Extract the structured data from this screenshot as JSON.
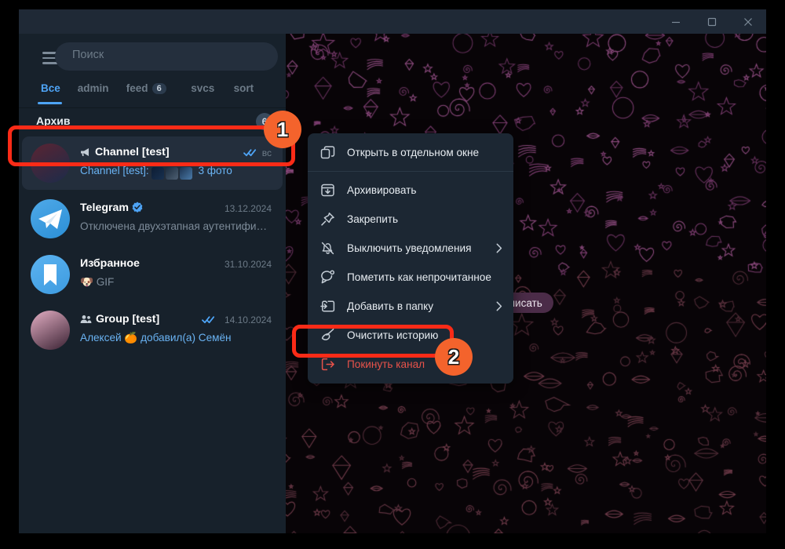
{
  "window": {
    "controls": [
      {
        "name": "minimize",
        "glyph": "minimize-icon"
      },
      {
        "name": "maximize",
        "glyph": "maximize-icon"
      },
      {
        "name": "close",
        "glyph": "close-icon"
      }
    ]
  },
  "sidebar": {
    "menu_icon": "hamburger-menu-icon",
    "search": {
      "placeholder": "Поиск",
      "value": ""
    },
    "tabs": [
      {
        "label": "Все",
        "badge": "",
        "active": true
      },
      {
        "label": "admin",
        "badge": "",
        "active": false
      },
      {
        "label": "feed",
        "badge": "6",
        "active": false
      },
      {
        "label": "svcs",
        "badge": "",
        "active": false
      },
      {
        "label": "sort",
        "badge": "",
        "active": false
      }
    ],
    "archive": {
      "label": "Архив",
      "count": "6"
    },
    "chats": [
      {
        "name": "Channel [test]",
        "name_prefix_icon": "megaphone-icon",
        "preview_prefix": "Channel [test]:",
        "preview": "3 фото",
        "preview_has_thumbs": true,
        "time": "вс",
        "read_ticks": true,
        "verified": false,
        "selected": true,
        "avatar_colors": [
          "#5a2432",
          "#1c2b4a"
        ]
      },
      {
        "name": "Telegram",
        "name_prefix_icon": "",
        "preview_prefix": "",
        "preview": "Отключена двухэтапная аутентификация!…",
        "preview_has_thumbs": false,
        "time": "13.12.2024",
        "read_ticks": false,
        "verified": true,
        "selected": false,
        "avatar_colors": [
          "#4fa9e8",
          "#2b8fd6"
        ]
      },
      {
        "name": "Избранное",
        "name_prefix_icon": "",
        "preview_prefix": "",
        "preview": "🐶 GIF",
        "preview_has_thumbs": false,
        "time": "31.10.2024",
        "read_ticks": false,
        "verified": false,
        "selected": false,
        "avatar_colors": [
          "#5cb3f0",
          "#3d9be0"
        ]
      },
      {
        "name": "Group [test]",
        "name_prefix_icon": "group-icon",
        "preview_prefix": "",
        "preview": "Алексей 🍊 добавил(а) Семён",
        "preview_has_thumbs": false,
        "time": "14.10.2024",
        "read_ticks": true,
        "verified": false,
        "selected": false,
        "avatar_colors": [
          "#e3aec3",
          "#3a2233"
        ]
      }
    ]
  },
  "right_pane": {
    "tooltip": "кому хотели бы написать"
  },
  "context_menu": {
    "items": [
      {
        "label": "Открыть в отдельном окне",
        "icon": "open-in-new-window-icon",
        "submenu": false,
        "danger": false,
        "separator_after": true
      },
      {
        "label": "Архивировать",
        "icon": "archive-box-icon",
        "submenu": false,
        "danger": false,
        "separator_after": false
      },
      {
        "label": "Закрепить",
        "icon": "pin-icon",
        "submenu": false,
        "danger": false,
        "separator_after": false
      },
      {
        "label": "Выключить уведомления",
        "icon": "mute-bell-icon",
        "submenu": true,
        "danger": false,
        "separator_after": false
      },
      {
        "label": "Пометить как непрочитанное",
        "icon": "unread-chat-icon",
        "submenu": false,
        "danger": false,
        "separator_after": false
      },
      {
        "label": "Добавить в папку",
        "icon": "add-to-folder-icon",
        "submenu": true,
        "danger": false,
        "separator_after": false
      },
      {
        "label": "Очистить историю",
        "icon": "broom-icon",
        "submenu": false,
        "danger": false,
        "separator_after": false
      },
      {
        "label": "Покинуть канал",
        "icon": "leave-exit-icon",
        "submenu": false,
        "danger": true,
        "separator_after": false
      }
    ]
  },
  "annotations": {
    "accent_color": "#fb2b17",
    "bubble_color": "#f4632c",
    "steps": [
      {
        "number": "1"
      },
      {
        "number": "2"
      }
    ]
  }
}
